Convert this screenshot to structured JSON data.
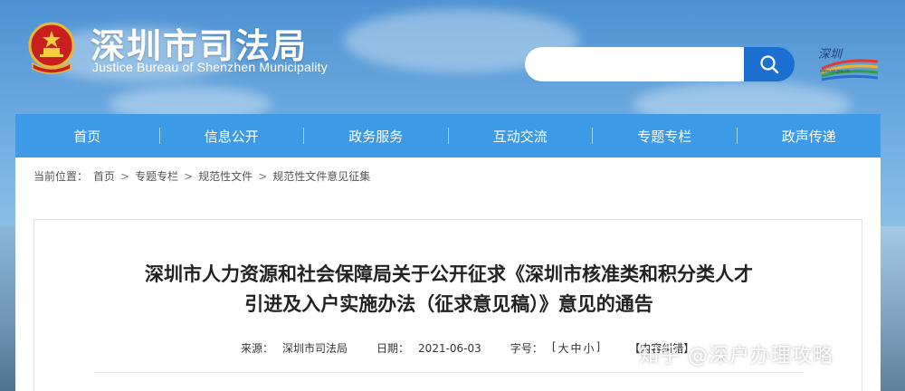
{
  "header": {
    "title": "深圳市司法局",
    "subtitle": "Justice Bureau of Shenzhen Municipality",
    "emblem_icon": "national-emblem-icon",
    "search": {
      "value": "",
      "placeholder": ""
    },
    "search_icon": "search-icon",
    "right_logo": "shenzhen-china-logo",
    "right_logo_caption": "www.sz.gov.cn"
  },
  "nav": {
    "items": [
      {
        "label": "首页"
      },
      {
        "label": "信息公开"
      },
      {
        "label": "政务服务"
      },
      {
        "label": "互动交流"
      },
      {
        "label": "专题专栏"
      },
      {
        "label": "政声传递"
      }
    ]
  },
  "breadcrumb": {
    "prefix": "当前位置：",
    "items": [
      "首页",
      "专题专栏",
      "规范性文件",
      "规范性文件意见征集"
    ],
    "separator": ">"
  },
  "article": {
    "title_line1": "深圳市人力资源和社会保障局关于公开征求《深圳市核准类和积分类人才",
    "title_line2": "引进及入户实施办法（征求意见稿）》意见的通告",
    "source_label": "来源：",
    "source_value": "深圳市司法局",
    "date_label": "日期：",
    "date_value": "2021-06-03",
    "fontsize_label": "字号：",
    "fontsize_open": "[",
    "fontsize_large": "大",
    "fontsize_medium": "中",
    "fontsize_small": "小",
    "fontsize_close": "]",
    "report_label": "【内容纠错】"
  },
  "watermark": "知乎 @深户办理攻略",
  "colors": {
    "nav_bg": "#3d9ae6",
    "search_btn": "#1a6fd1",
    "title_text": "#222222"
  }
}
